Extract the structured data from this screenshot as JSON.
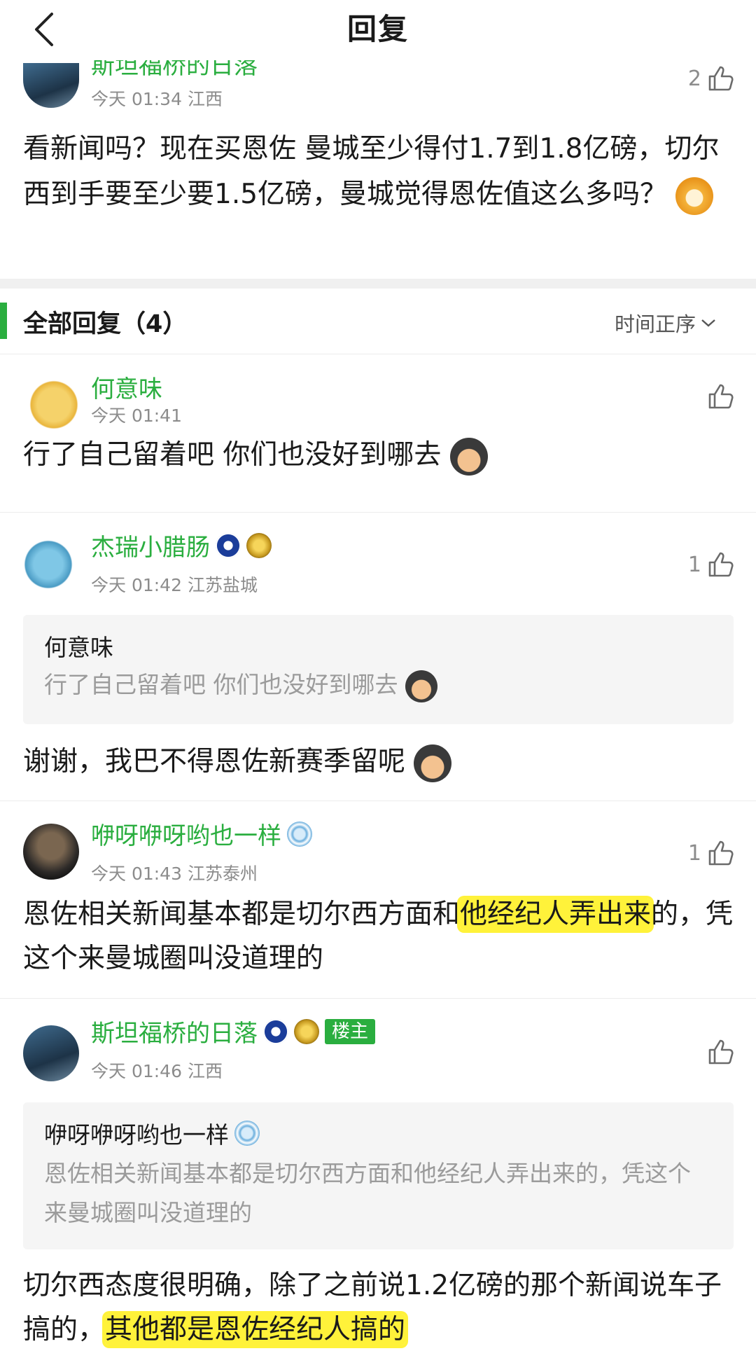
{
  "header": {
    "title": "回复"
  },
  "original_post": {
    "author": "斯坦福桥的日落",
    "meta": "今天 01:34 江西",
    "likes": "2",
    "text": "看新闻吗？现在买恩佐 曼城至少得付1.7到1.8亿磅，切尔西到手要至少要1.5亿磅，曼城觉得恩佐值这么多吗？"
  },
  "section": {
    "title": "全部回复（4）",
    "sort": "时间正序"
  },
  "replies": [
    {
      "author": "何意味",
      "meta": "今天 01:41",
      "likes": "",
      "text": "行了自己留着吧 你们也没好到哪去"
    },
    {
      "author": "杰瑞小腊肠",
      "meta": "今天 01:42 江苏盐城",
      "likes": "1",
      "quote_author": "何意味",
      "quote_text": "行了自己留着吧 你们也没好到哪去",
      "text": "谢谢，我巴不得恩佐新赛季留呢"
    },
    {
      "author": "咿呀咿呀哟也一样",
      "meta": "今天 01:43 江苏泰州",
      "likes": "1",
      "text_part1": "恩佐相关新闻基本都是切尔西方面和",
      "text_highlight": "他经纪人弄出来",
      "text_part2": "的，凭这个来曼城圈叫没道理的"
    },
    {
      "author": "斯坦福桥的日落",
      "host_tag": "楼主",
      "meta": "今天 01:46 江西",
      "likes": "",
      "quote_author": "咿呀咿呀哟也一样",
      "quote_text": "恩佐相关新闻基本都是切尔西方面和他经纪人弄出来的，凭这个来曼城圈叫没道理的",
      "text_part1": "切尔西态度很明确，除了之前说1.2亿磅的那个新闻说车子搞的，",
      "text_highlight": "其他都是恩佐经纪人搞的"
    }
  ],
  "colors": {
    "accent_green": "#2aae3f",
    "highlight": "#fff23a"
  },
  "icons": [
    "back-icon",
    "thumbs-up-icon",
    "chevron-down-icon",
    "chelsea-badge-icon",
    "gold-medal-icon",
    "man-city-badge-icon"
  ]
}
